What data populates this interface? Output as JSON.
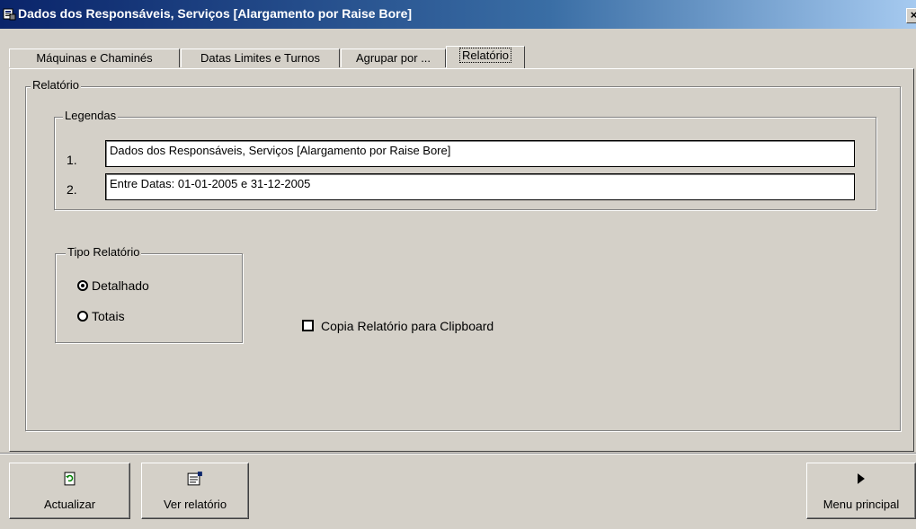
{
  "window": {
    "title": "Dados dos Responsáveis, Serviços [Alargamento por Raise Bore]",
    "close_glyph": "×",
    "icon": "app-icon"
  },
  "tabs": [
    {
      "label": "Máquinas e Chaminés",
      "active": false
    },
    {
      "label": "Datas Limites e Turnos",
      "active": false
    },
    {
      "label": "Agrupar por ...",
      "active": false
    },
    {
      "label": "Relatório",
      "active": true
    }
  ],
  "relatorio": {
    "group_label": "Relatório",
    "legendas": {
      "group_label": "Legendas",
      "rows": [
        {
          "num": "1.",
          "value": "Dados dos Responsáveis, Serviços [Alargamento por Raise Bore]"
        },
        {
          "num": "2.",
          "value": "Entre Datas: 01-01-2005 e 31-12-2005"
        }
      ]
    },
    "tipo": {
      "group_label": "Tipo Relatório",
      "options": [
        {
          "label": "Detalhado",
          "selected": true
        },
        {
          "label": "Totais",
          "selected": false
        }
      ]
    },
    "clipboard": {
      "label": "Copia Relatório para Clipboard",
      "checked": false
    }
  },
  "buttons": {
    "refresh": {
      "label": "Actualizar",
      "icon": "refresh-icon"
    },
    "view": {
      "label": "Ver relatório",
      "icon": "report-icon"
    },
    "menu": {
      "label": "Menu principal",
      "icon": "play-arrow-icon"
    }
  }
}
